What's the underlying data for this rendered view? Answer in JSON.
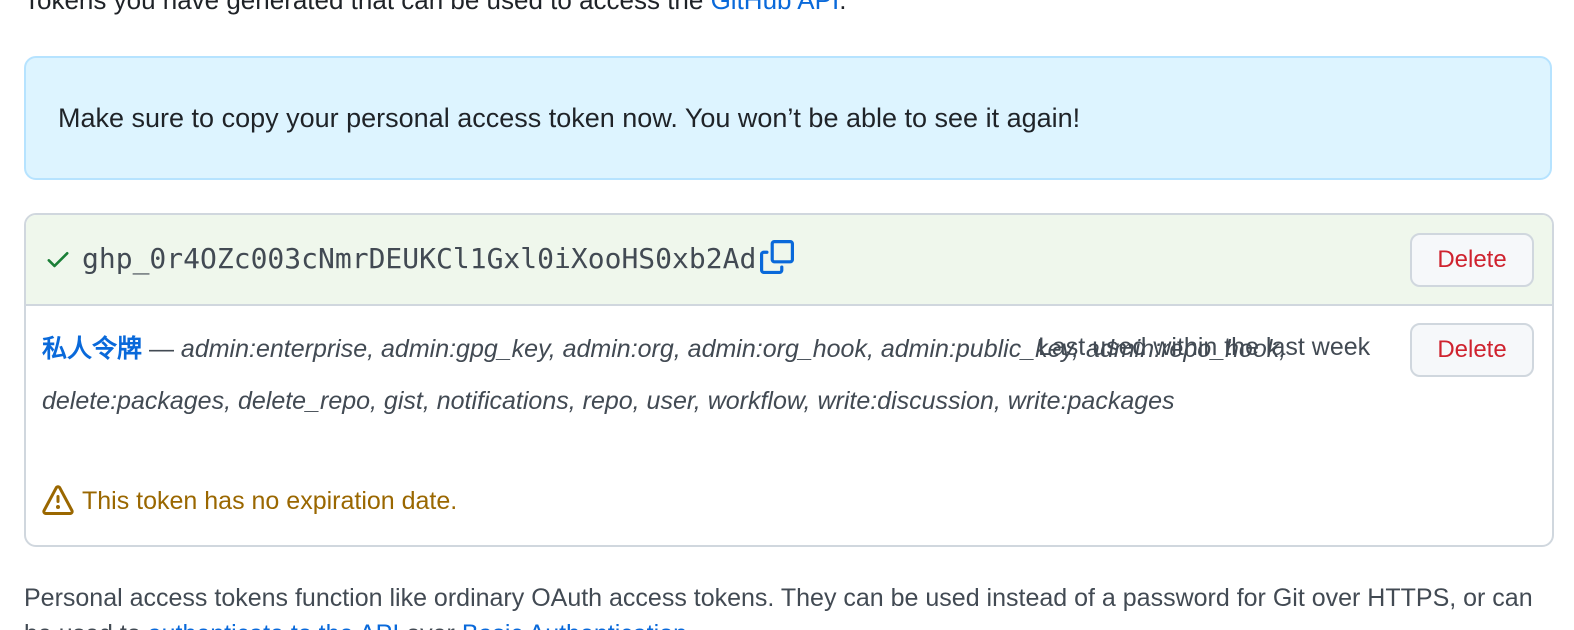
{
  "intro": {
    "text": "Tokens you have generated that can be used to access the ",
    "link": "GitHub API",
    "suffix": "."
  },
  "flash": {
    "message": "Make sure to copy your personal access token now. You won’t be able to see it again!"
  },
  "new_token": {
    "value": "ghp_0r4OZc003cNmrDEUKCl1Gxl0iXooHS0xb2Ad",
    "delete_label": "Delete",
    "icons": [
      "check-icon",
      "copy-icon"
    ],
    "status_color": "#1a7f37"
  },
  "token": {
    "name": "私人令牌",
    "dash": " — ",
    "scopes": "admin:enterprise, admin:gpg_key, admin:org, admin:org_hook, admin:public_key, admin:repo_hook, delete:packages, delete_repo, gist, notifications, repo, user, workflow, write:discussion, write:packages",
    "last_used": "Last used within the last week",
    "delete_label": "Delete",
    "warning": "This token has no expiration date.",
    "warning_icon": "alert-icon"
  },
  "footer": {
    "text": "Personal access tokens function like ordinary OAuth access tokens. They can be used instead of a password for Git over HTTPS, or can",
    "line2_prefix": "be used to ",
    "line2_link1": "authenticate to the API",
    "line2_mid": " over ",
    "line2_link2": "Basic Authentication",
    "line2_suffix": "."
  },
  "colors": {
    "link": "#0969da",
    "danger": "#cf222e",
    "warning": "#9a6700",
    "flash_bg": "#ddf4ff",
    "success_bg": "#eff7ec"
  }
}
